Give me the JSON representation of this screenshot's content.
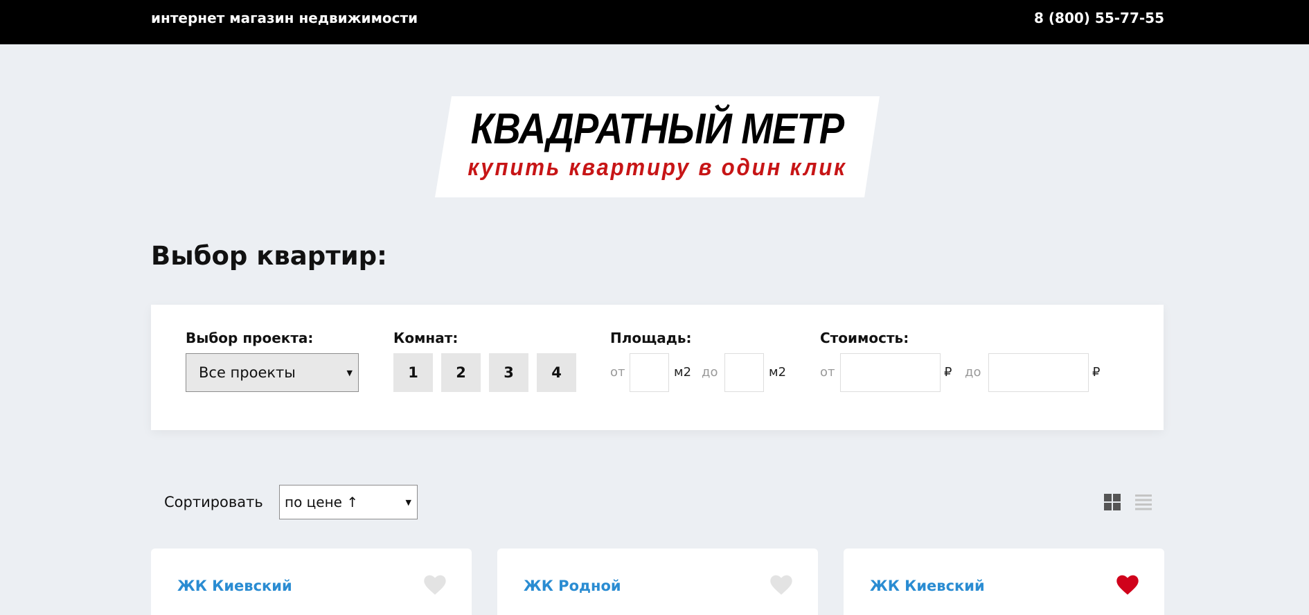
{
  "header": {
    "tagline": "интернет магазин недвижимости",
    "phone": "8 (800) 55-77-55"
  },
  "logo": {
    "title": "КВАДРАТНЫЙ МЕТР",
    "subtitle": "купить квартиру в один клик",
    "title_color": "#000000",
    "subtitle_color": "#c71516"
  },
  "page": {
    "heading": "Выбор квартир:"
  },
  "filters": {
    "project": {
      "label": "Выбор проекта:",
      "selected": "Все проекты",
      "caret": "▼"
    },
    "rooms": {
      "label": "Комнат:",
      "options": [
        "1",
        "2",
        "3",
        "4"
      ]
    },
    "area": {
      "label": "Площадь:",
      "from": "от",
      "to": "до",
      "unit": "м2",
      "from_value": "",
      "to_value": ""
    },
    "price": {
      "label": "Стоимость:",
      "from": "от",
      "to": "до",
      "currency": "₽",
      "from_value": "",
      "to_value": ""
    }
  },
  "sort": {
    "label": "Сортировать",
    "selected": "по цене ↑",
    "caret": "▼"
  },
  "view_toggle": {
    "grid_icon": "grid-view-icon",
    "list_icon": "list-view-icon",
    "active": "grid"
  },
  "cards": [
    {
      "name": "ЖК Киевский",
      "favorite": false
    },
    {
      "name": "ЖК Родной",
      "favorite": false
    },
    {
      "name": "ЖК Киевский",
      "favorite": true
    }
  ],
  "colors": {
    "accent_link": "#2a8cd2",
    "heart_active": "#d0021b",
    "heart_inactive": "#e3e3e3",
    "topbar": "#000000",
    "background": "#eceff3"
  }
}
